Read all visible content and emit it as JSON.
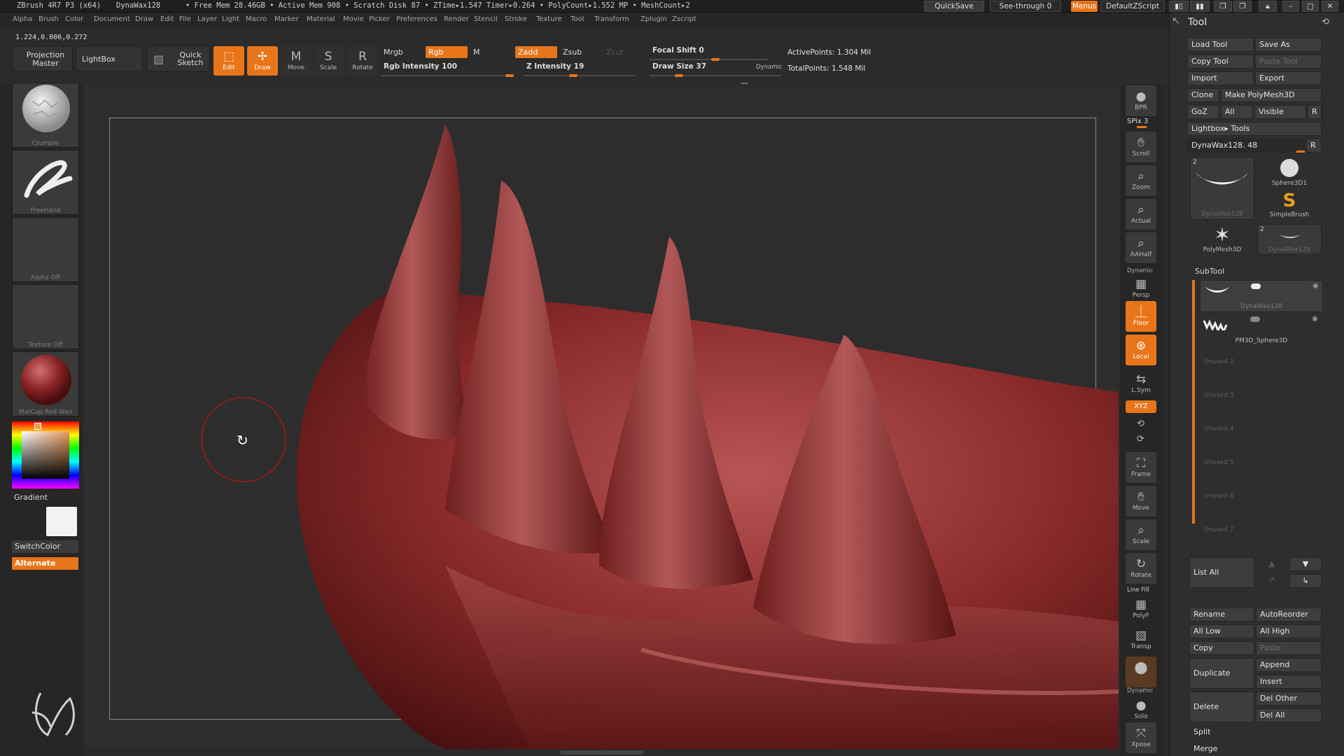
{
  "titlebar": {
    "app": "ZBrush 4R7 P3 (x64)",
    "doc": "DynaWax128",
    "stats": "• Free Mem 28.46GB • Active Mem 908 • Scratch Disk 87 • ZTime▸1.547 Timer▸0.264 • PolyCount▸1.552 MP • MeshCount▸2",
    "quicksave": "QuickSave",
    "seethrough": "See-through  0",
    "menus": "Menus",
    "defaultzscript": "DefaultZScript"
  },
  "menubar": [
    "Alpha",
    "Brush",
    "Color",
    "Document",
    "Draw",
    "Edit",
    "File",
    "Layer",
    "Light",
    "Macro",
    "Marker",
    "Material",
    "Movie",
    "Picker",
    "Preferences",
    "Render",
    "Stencil",
    "Stroke",
    "Texture",
    "Tool",
    "Transform",
    "Zplugin",
    "Zscript"
  ],
  "toolbar": {
    "coords": "1.224,0.006,0.272",
    "projection_master": "Projection Master",
    "lightbox": "LightBox",
    "quick_sketch": "Quick Sketch",
    "edit": "Edit",
    "draw": "Draw",
    "move": "Move",
    "scale": "Scale",
    "rotate": "Rotate",
    "mrgb": "Mrgb",
    "rgb": "Rgb",
    "m": "M",
    "zadd": "Zadd",
    "zsub": "Zsub",
    "zcut": "Zcut",
    "rgb_intensity": "Rgb Intensity 100",
    "z_intensity": "Z Intensity 19",
    "focal_shift": "Focal Shift 0",
    "draw_size": "Draw Size 37",
    "dynamic": "Dynamic",
    "active_points": "ActivePoints: 1.304  Mil",
    "total_points": "TotalPoints: 1.548  Mil"
  },
  "left": {
    "brush": "Crumple",
    "stroke": "FreeHand",
    "alpha": "Alpha  Off",
    "texture": "Texture  Off",
    "material": "MatCap Red Wax",
    "gradient": "Gradient",
    "switchcolor": "SwitchColor",
    "alternate": "Alternate"
  },
  "right_shelf": {
    "bpr": "BPR",
    "spix": "SPix 3",
    "scroll": "Scroll",
    "zoom": "Zoom",
    "actual": "Actual",
    "aahalf": "AAHalf",
    "dynamic": "Dynamic",
    "persp": "Persp",
    "floor": "Floor",
    "local": "Local",
    "lsym": "L.Sym",
    "xyz": "XYZ",
    "frame": "Frame",
    "move": "Move",
    "scale": "Scale",
    "rotate": "Rotate",
    "linefill": "Line Fill",
    "polyf": "PolyF",
    "transp": "Transp",
    "dynamic2": "Dynamic",
    "solo": "Solo",
    "xpose": "Xpose"
  },
  "palette": {
    "title": "Tool",
    "load_tool": "Load Tool",
    "save_as": "Save As",
    "copy_tool": "Copy Tool",
    "paste_tool": "Paste Tool",
    "import": "Import",
    "export": "Export",
    "clone": "Clone",
    "make_polymesh": "Make PolyMesh3D",
    "goz": "GoZ",
    "all": "All",
    "visible": "Visible",
    "r": "R",
    "lightbox_tools": "Lightbox▸ Tools",
    "current_tool": "DynaWax128. 48",
    "tools": [
      "DynaWax128",
      "Sphere3D1",
      "SimpleBrush",
      "PolyMesh3D",
      "DynaWax128"
    ],
    "tool_count_a": "2",
    "tool_count_b": "2",
    "subtool": "SubTool",
    "subtools": [
      "DynaWax128",
      "PM3D_Sphere3D"
    ],
    "unused": [
      "Unused 2",
      "Unused 3",
      "Unused 4",
      "Unused 5",
      "Unused 6",
      "Unused 7"
    ],
    "list_all": "List  All",
    "rename": "Rename",
    "autoreorder": "AutoReorder",
    "all_low": "All Low",
    "all_high": "All High",
    "copy": "Copy",
    "paste": "Paste",
    "duplicate": "Duplicate",
    "append": "Append",
    "insert": "Insert",
    "delete": "Delete",
    "del_other": "Del Other",
    "del_all": "Del All",
    "split": "Split",
    "merge": "Merge"
  },
  "colors": {
    "accent": "#e87519",
    "wax": "#8e2b2b",
    "bg": "#2d2d2d"
  }
}
